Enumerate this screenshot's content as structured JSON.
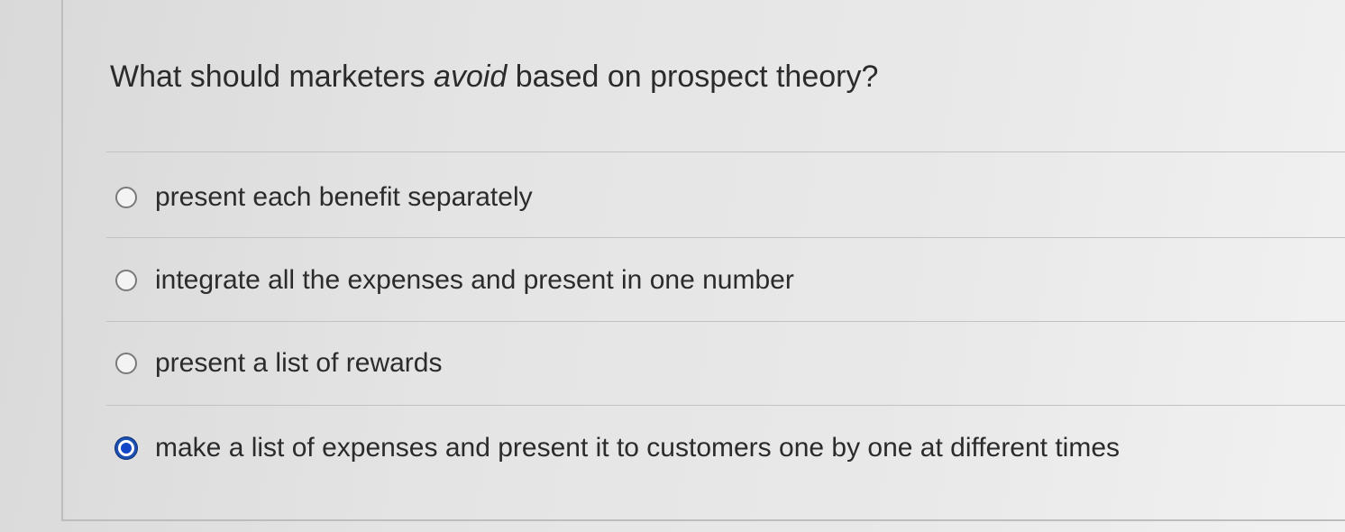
{
  "question": {
    "prefix": "What should marketers ",
    "emphasis": "avoid",
    "suffix": " based on prospect theory?"
  },
  "options": [
    {
      "label": "present each benefit separately",
      "selected": false
    },
    {
      "label": "integrate all the expenses and present in one number",
      "selected": false
    },
    {
      "label": "present a list of rewards",
      "selected": false
    },
    {
      "label": "make a list of expenses and present it to customers one by one at different times",
      "selected": true
    }
  ],
  "colors": {
    "selected_radio": "#1347c8",
    "text": "#2b2b2b"
  }
}
